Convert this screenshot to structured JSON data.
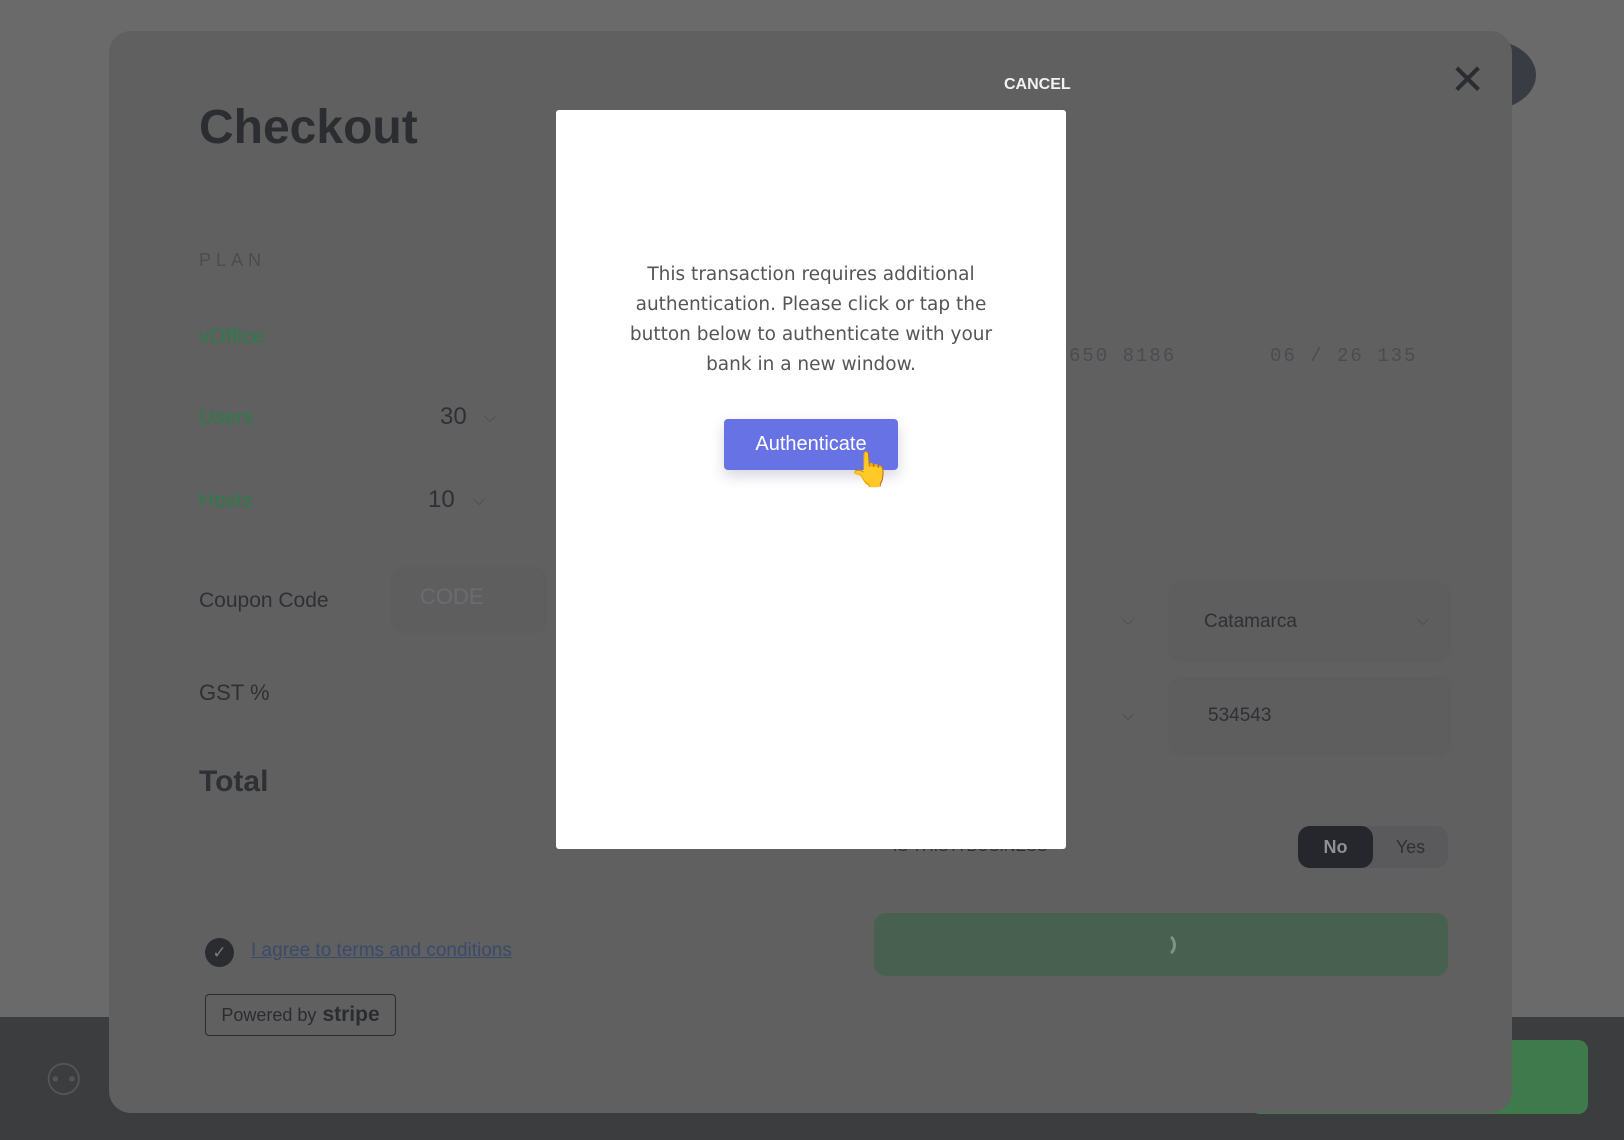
{
  "checkout": {
    "title": "Checkout",
    "plan_label": "PLAN",
    "plan_name": "vOffice",
    "users_label": "Users",
    "users_value": "30",
    "hosts_label": "Hosts",
    "hosts_value": "10",
    "coupon_label": "Coupon Code",
    "coupon_placeholder": "CODE",
    "gst_label": "GST %",
    "total_label": "Total",
    "card_number_partial": "650 8186",
    "card_expiry_cvc": "06 / 26 135",
    "state_value": "Catamarca",
    "postal_value": "534543",
    "business_label": "IS THIS A BUSINESS",
    "business_options": [
      "No",
      "Yes"
    ],
    "business_selected": "No",
    "terms_label": "I agree to terms and conditions",
    "terms_checked": true,
    "powered_by": "Powered by",
    "stripe": "stripe"
  },
  "modal": {
    "cancel_label": "CANCEL",
    "message": "This transaction requires additional authentication. Please click or tap the button below to authenticate with your bank in a new window.",
    "authenticate_label": "Authenticate"
  },
  "colors": {
    "accent": "#6772e5",
    "plan_green": "#2e7a4a"
  },
  "icons": [
    "close-icon",
    "chevron-down-icon",
    "check-icon",
    "spinner-icon",
    "hand-cursor-icon"
  ]
}
